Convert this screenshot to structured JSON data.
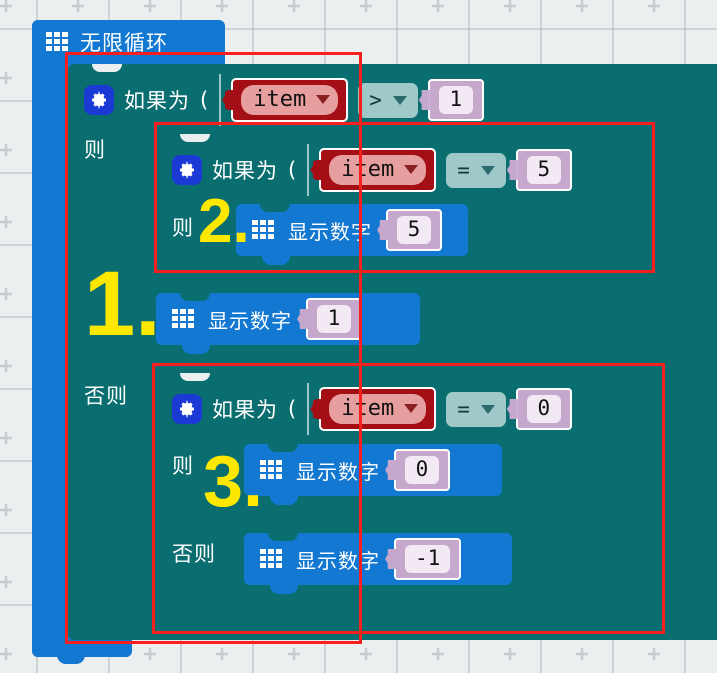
{
  "editor": {
    "name": "block-programming-canvas",
    "background_color": "#ebeff0",
    "grid": "crosshair-dots"
  },
  "loop": {
    "icon": "led-grid-icon",
    "label": "无限循环",
    "color": "#1278d1"
  },
  "labels": {
    "then": "则",
    "else": "否则",
    "if": "如果为",
    "show_number": "显示数字",
    "paren_open": "("
  },
  "colors": {
    "loop_blue": "#1278d1",
    "conditional_teal": "#0a6e71",
    "variable_red": "#a30f14",
    "variable_field": "#e79e9e",
    "operator_teal": "#9ec9c8",
    "number_lavender": "#c6a8cd",
    "number_field": "#f2e9f5",
    "annotation_red": "#fa1f1f",
    "annotation_yellow": "#ffe800"
  },
  "conditionals": [
    {
      "id": "cond-1",
      "icon": "gear-icon",
      "if_label": "如果为",
      "variable": "item",
      "operator": ">",
      "value": "1",
      "then_label": "则",
      "else_label": "否则",
      "annotation": "1."
    },
    {
      "id": "cond-2",
      "icon": "gear-icon",
      "if_label": "如果为",
      "variable": "item",
      "operator": "=",
      "value": "5",
      "then_label": "则",
      "annotation": "2."
    },
    {
      "id": "cond-3",
      "icon": "gear-icon",
      "if_label": "如果为",
      "variable": "item",
      "operator": "=",
      "value": "0",
      "then_label": "则",
      "else_label": "否则",
      "annotation": "3."
    }
  ],
  "show_number_blocks": [
    {
      "id": "show-5",
      "icon": "led-grid-icon",
      "label": "显示数字",
      "value": "5"
    },
    {
      "id": "show-1",
      "icon": "led-grid-icon",
      "label": "显示数字",
      "value": "1"
    },
    {
      "id": "show-0",
      "icon": "led-grid-icon",
      "label": "显示数字",
      "value": "0"
    },
    {
      "id": "show-n1",
      "icon": "led-grid-icon",
      "label": "显示数字",
      "value": "-1"
    }
  ],
  "annotations": [
    {
      "id": "ann-1",
      "text": "1."
    },
    {
      "id": "ann-2",
      "text": "2."
    },
    {
      "id": "ann-3",
      "text": "3."
    }
  ]
}
